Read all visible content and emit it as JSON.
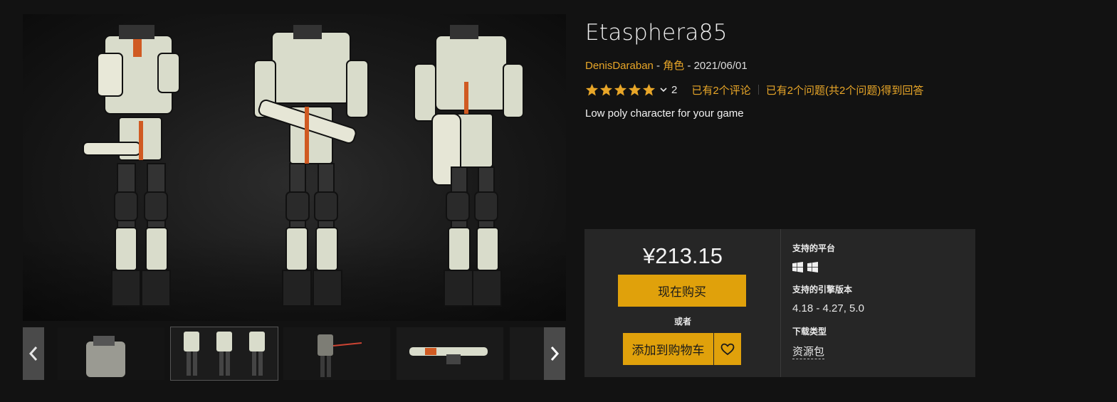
{
  "product": {
    "title": "Etasphera85",
    "author": "DenisDaraban",
    "category": "角色",
    "date": "2021/06/01",
    "sep1": " - ",
    "sep2": " - ",
    "rating_stars": 5,
    "rating_count": "2",
    "reviews_link": "已有2个评论",
    "questions_link": "已有2个问题(共2个问题)得到回答",
    "description": "Low poly character for your game"
  },
  "purchase": {
    "price": "¥213.15",
    "buy_label": "现在购买",
    "or_label": "或者",
    "cart_label": "添加到购物车"
  },
  "specs": {
    "platforms_label": "支持的平台",
    "platform_icons": [
      "windows-icon",
      "windows-icon"
    ],
    "engine_label": "支持的引擎版本",
    "engine_value": "4.18 - 4.27, 5.0",
    "download_label": "下载类型",
    "download_value": "资源包"
  },
  "gallery": {
    "thumbnails": [
      "robot-closeup",
      "robot-turnaround",
      "robot-firing",
      "rifle-closeup",
      "partial"
    ],
    "active_index": 1
  },
  "colors": {
    "accent": "#e8a628",
    "button": "#e0a10b",
    "background": "#121212",
    "panel": "#262626"
  }
}
